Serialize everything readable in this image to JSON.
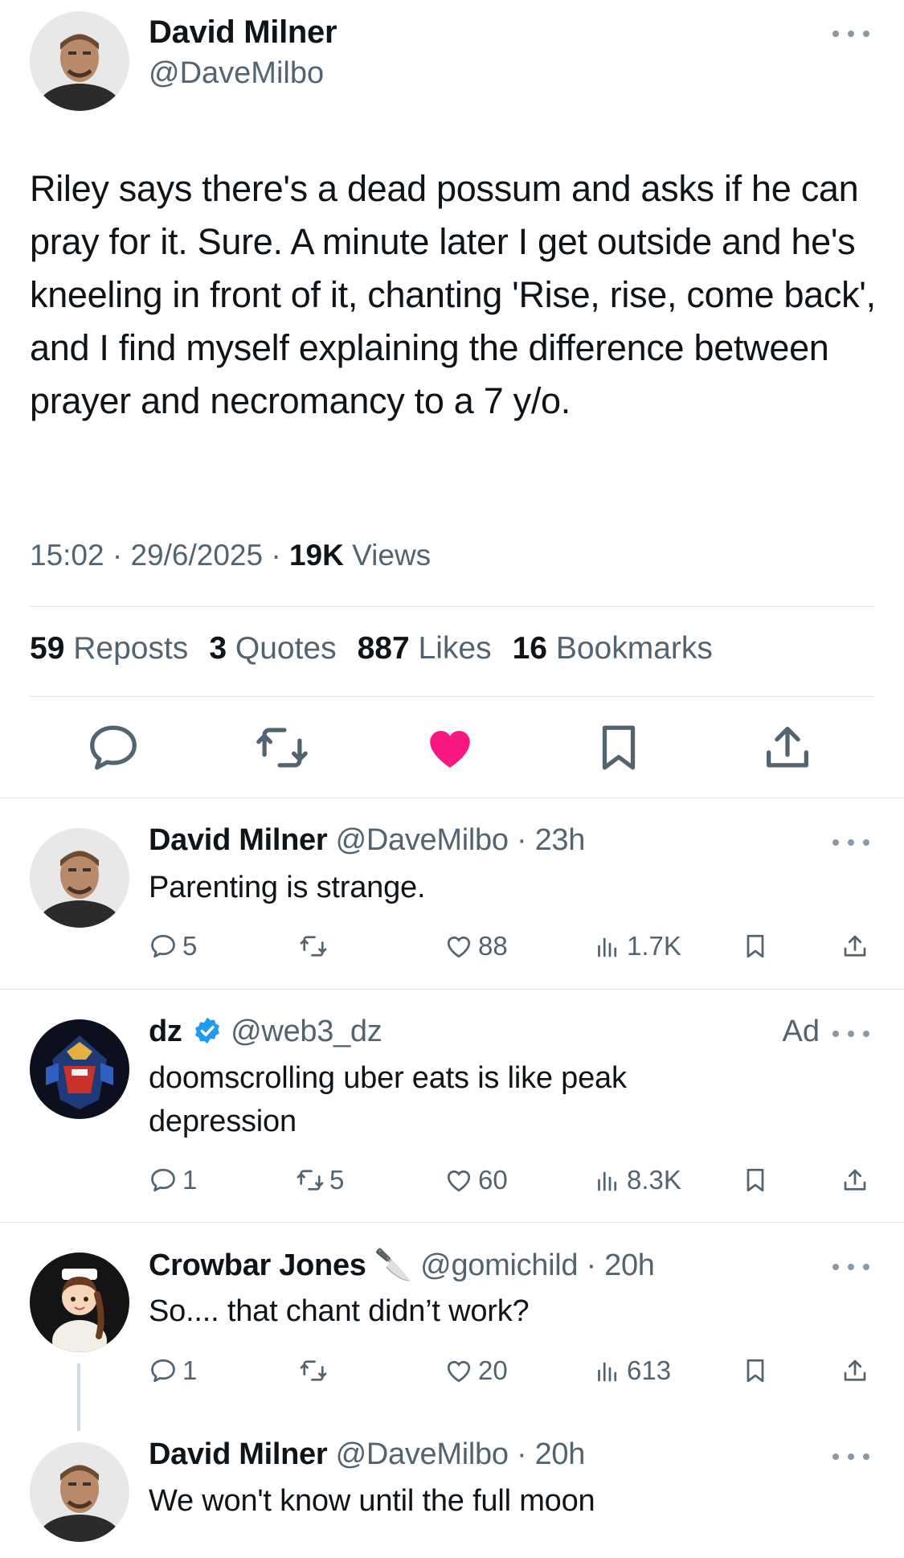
{
  "main_tweet": {
    "author_name": "David Milner",
    "author_handle": "@DaveMilbo",
    "text": "Riley says there's a dead possum and asks if he can pray for it. Sure. A minute later I get outside and he's kneeling in front of it, chanting 'Rise, rise, come back', and I find myself explaining the difference between prayer and necromancy to a 7 y/o.",
    "time": "15:02",
    "date": "29/6/2025",
    "views_count": "19K",
    "views_label": "Views",
    "separator": "·",
    "stats": [
      {
        "count": "59",
        "label": "Reposts"
      },
      {
        "count": "3",
        "label": "Quotes"
      },
      {
        "count": "887",
        "label": "Likes"
      },
      {
        "count": "16",
        "label": "Bookmarks"
      }
    ],
    "actions": [
      "reply-icon",
      "repost-icon",
      "like-icon-filled",
      "bookmark-icon",
      "share-icon"
    ],
    "liked_color": "#f91880"
  },
  "replies": [
    {
      "author_name": "David Milner",
      "author_handle": "@DaveMilbo",
      "time": "· 23h",
      "text": "Parenting is strange.",
      "replies": "5",
      "reposts": "",
      "likes": "88",
      "views": "1.7K"
    },
    {
      "author_name": "dz",
      "verified": true,
      "author_handle": "@web3_dz",
      "time": "",
      "ad_label": "Ad",
      "text": "doomscrolling uber eats is like peak depression",
      "replies": "1",
      "reposts": "5",
      "likes": "60",
      "views": "8.3K"
    },
    {
      "author_name": "Crowbar Jones",
      "name_emoji": "🔪",
      "author_handle": "@gomichild",
      "time": "· 20h",
      "text": "So.... that chant didn’t work?",
      "replies": "1",
      "reposts": "",
      "likes": "20",
      "views": "613"
    },
    {
      "author_name": "David Milner",
      "author_handle": "@DaveMilbo",
      "time": "· 20h",
      "text": "We won't know until the full moon"
    }
  ],
  "colors": {
    "text_primary": "#0f1419",
    "text_secondary": "#536471",
    "verified_blue": "#1d9bf0",
    "divider": "#e1e5e8"
  }
}
